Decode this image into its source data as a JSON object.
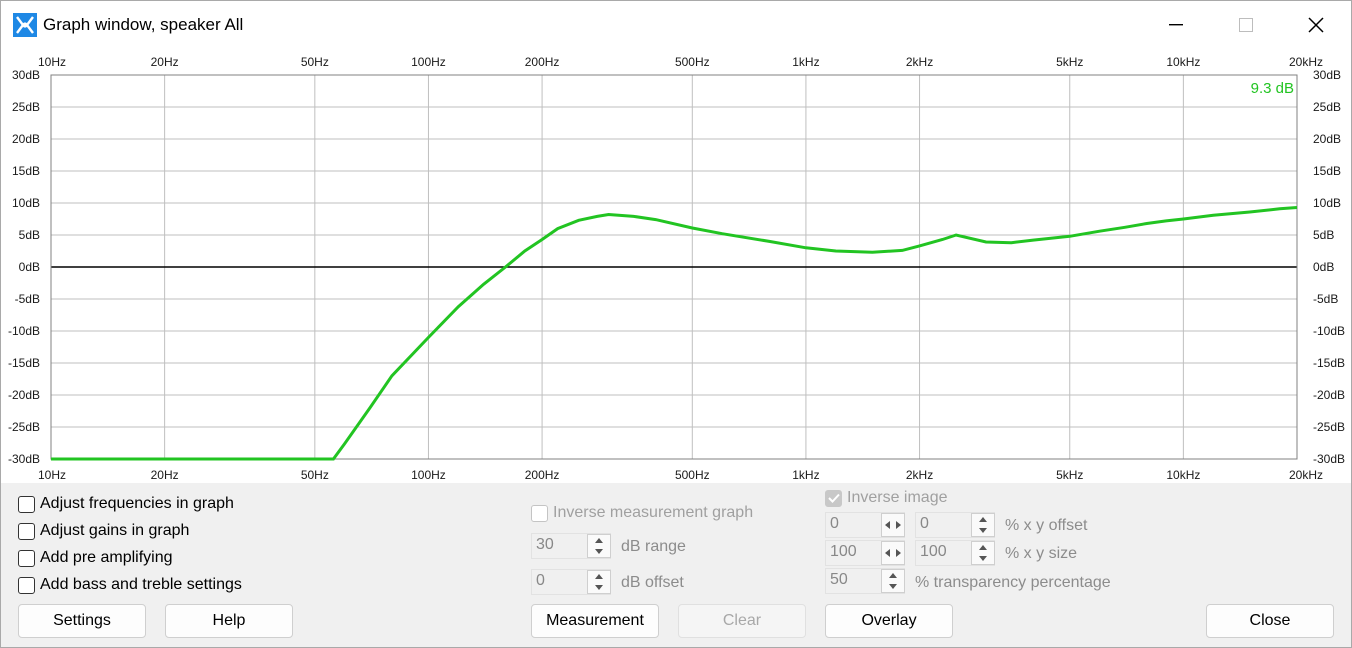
{
  "window": {
    "title": "Graph window, speaker All"
  },
  "graph": {
    "peak_label": "9.3 dB",
    "freq_labels": [
      "10Hz",
      "20Hz",
      "50Hz",
      "100Hz",
      "200Hz",
      "500Hz",
      "1kHz",
      "2kHz",
      "5kHz",
      "10kHz",
      "20kHz"
    ],
    "db_labels": [
      "30dB",
      "25dB",
      "20dB",
      "15dB",
      "10dB",
      "5dB",
      "0dB",
      "-5dB",
      "-10dB",
      "-15dB",
      "-20dB",
      "-25dB",
      "-30dB"
    ]
  },
  "chart_data": {
    "type": "line",
    "xscale": "log",
    "xlim": [
      10,
      20000
    ],
    "ylim": [
      -30,
      30
    ],
    "grid": true,
    "series": [
      {
        "color": "#22c422",
        "x": [
          10,
          30,
          56,
          60,
          70,
          80,
          100,
          120,
          140,
          160,
          180,
          200,
          220,
          250,
          280,
          300,
          350,
          400,
          500,
          600,
          800,
          1000,
          1200,
          1500,
          1800,
          2000,
          2300,
          2500,
          3000,
          3500,
          4000,
          5000,
          6000,
          7000,
          8000,
          9000,
          10000,
          12000,
          15000,
          18000,
          20000
        ],
        "y": [
          -30,
          -30,
          -30,
          -27.6,
          -22,
          -17,
          -11,
          -6.2,
          -2.7,
          0,
          2.5,
          4.3,
          6.0,
          7.3,
          7.9,
          8.2,
          7.9,
          7.4,
          6.1,
          5.2,
          4.0,
          3.0,
          2.5,
          2.3,
          2.6,
          3.3,
          4.3,
          5.0,
          3.9,
          3.8,
          4.2,
          4.8,
          5.6,
          6.2,
          6.8,
          7.2,
          7.5,
          8.1,
          8.6,
          9.1,
          9.3
        ]
      }
    ]
  },
  "checkboxes": {
    "adjust_freq": "Adjust frequencies in graph",
    "adjust_gains": "Adjust gains in graph",
    "pre_amp": "Add pre amplifying",
    "bass_treble": "Add bass and treble settings"
  },
  "measurement_panel": {
    "inverse_measurement_label": "Inverse measurement graph",
    "db_range_value": "30",
    "db_range_label": "dB range",
    "db_offset_value": "0",
    "db_offset_label": "dB offset"
  },
  "overlay_panel": {
    "inverse_image_label": "Inverse image",
    "x_offset": "0",
    "y_offset": "0",
    "offset_label": "% x y offset",
    "x_size": "100",
    "y_size": "100",
    "size_label": "% x y size",
    "transparency": "50",
    "transparency_label": "% transparency percentage"
  },
  "buttons": {
    "settings": "Settings",
    "help": "Help",
    "measurement": "Measurement",
    "clear": "Clear",
    "overlay": "Overlay",
    "close": "Close"
  }
}
